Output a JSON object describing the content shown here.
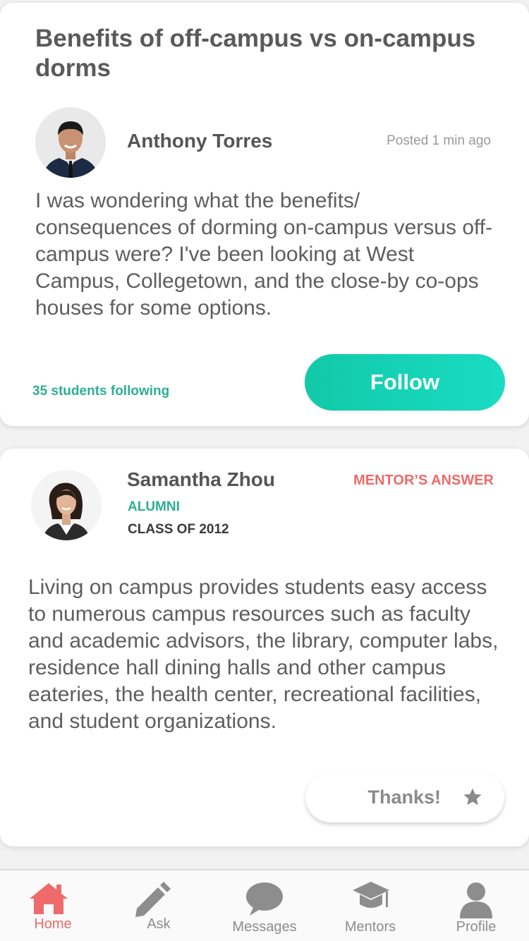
{
  "question": {
    "title": "Benefits of off-campus vs on-campus dorms",
    "author": "Anthony Torres",
    "posted": "Posted 1 min ago",
    "body": "I was wondering what the benefits/ consequences of dorming on-campus versus off-campus were? I've been looking at West Campus, Collegetown, and the close-by co-ops houses for some options.",
    "following": "35 students following",
    "follow_label": "Follow"
  },
  "answer": {
    "author": "Samantha Zhou",
    "tag": "MENTOR’S ANSWER",
    "role": "ALUMNI",
    "class_of": "CLASS OF 2012",
    "body": "Living on campus provides students easy access to numerous campus resources such as faculty and academic advisors, the library, computer labs, residence hall dining halls and other campus eateries, the health center, recreational facilities, and student organizations.",
    "thanks_label": "Thanks!"
  },
  "tabs": [
    {
      "label": "Home",
      "icon": "home-icon",
      "active": true
    },
    {
      "label": "Ask",
      "icon": "pencil-icon",
      "active": false
    },
    {
      "label": "Messages",
      "icon": "chat-bubble-icon",
      "active": false
    },
    {
      "label": "Mentors",
      "icon": "graduation-cap-icon",
      "active": false
    },
    {
      "label": "Profile",
      "icon": "person-icon",
      "active": false
    }
  ],
  "colors": {
    "accent_teal": "#19dcc3",
    "teal_text": "#2fae96",
    "mentor_red": "#ef6a6a",
    "icon_gray": "#8d8d8d"
  }
}
